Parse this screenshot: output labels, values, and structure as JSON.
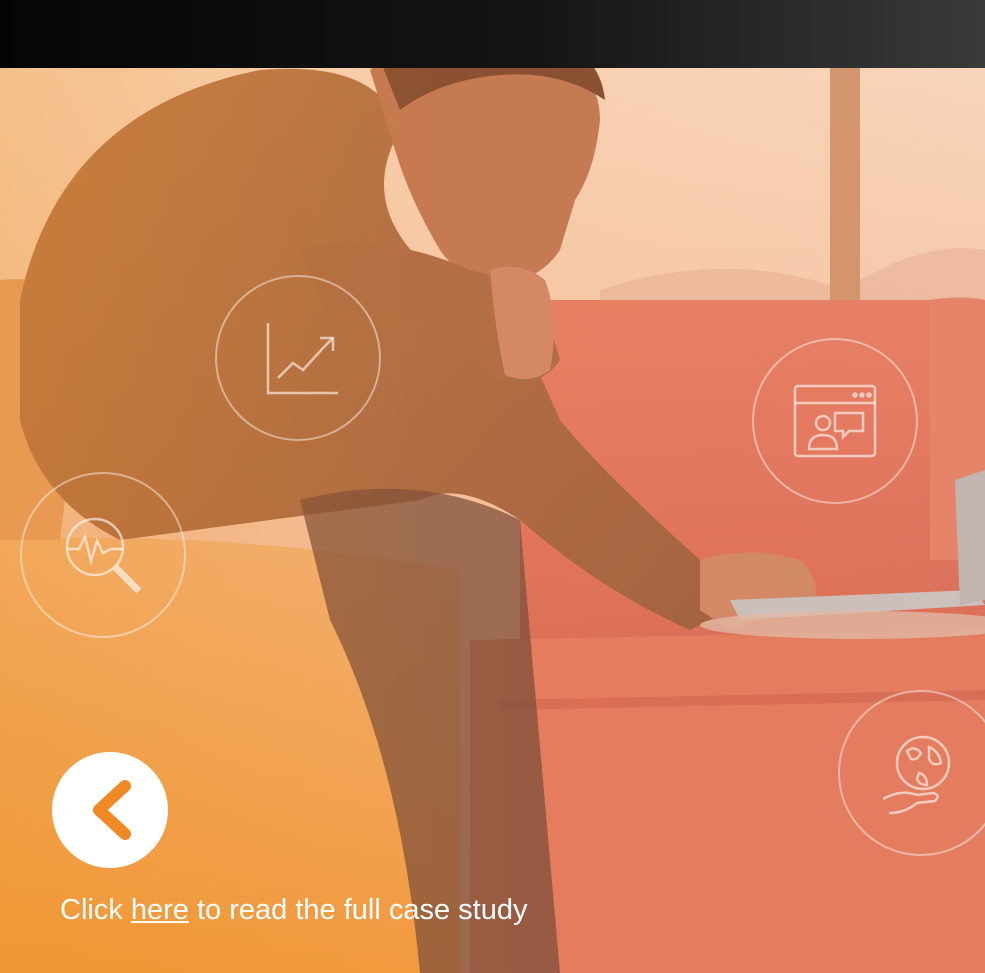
{
  "colors": {
    "accent_orange": "#f08a24",
    "top_bar": "#0d0d0d",
    "cta_text": "#ffffff",
    "chevron": "#f08a24"
  },
  "icons": {
    "growth_chart": "growth-chart-icon",
    "video_chat": "video-chat-icon",
    "health_search": "health-search-icon",
    "globe_in_hand": "globe-hand-icon",
    "back": "chevron-left-icon"
  },
  "cta": {
    "prefix": "Click ",
    "link_text": "here",
    "suffix": " to read the full case study"
  }
}
